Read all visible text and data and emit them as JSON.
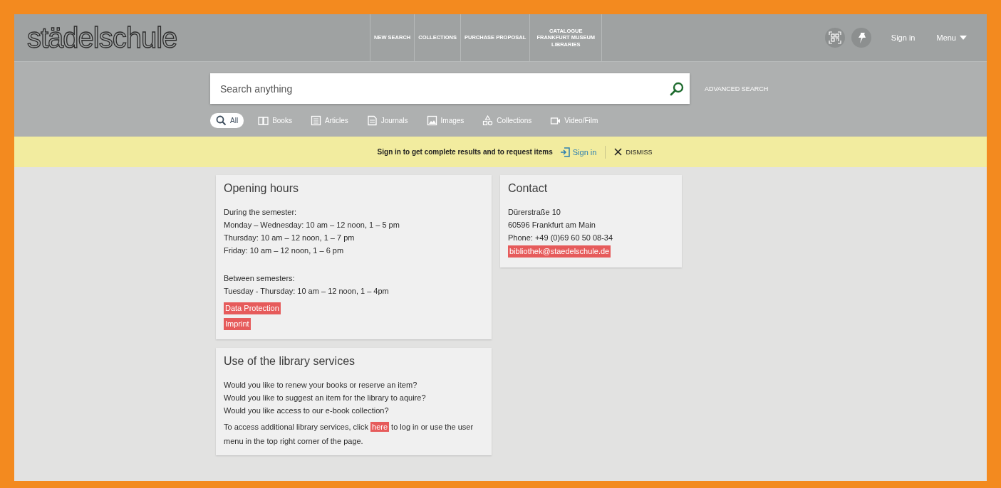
{
  "header": {
    "logo": "städelschule",
    "nav": [
      {
        "label": "NEW SEARCH"
      },
      {
        "label": "COLLECTIONS"
      },
      {
        "label": "PURCHASE PROPOSAL"
      },
      {
        "label": "CATALOGUE FRANKFURT MUSEUM LIBRARIES"
      }
    ],
    "sign_in": "Sign in",
    "menu": "Menu"
  },
  "search": {
    "placeholder": "Search anything",
    "advanced": "ADVANCED SEARCH",
    "scopes": [
      {
        "label": "All",
        "selected": true
      },
      {
        "label": "Books",
        "selected": false
      },
      {
        "label": "Articles",
        "selected": false
      },
      {
        "label": "Journals",
        "selected": false
      },
      {
        "label": "Images",
        "selected": false
      },
      {
        "label": "Collections",
        "selected": false
      },
      {
        "label": "Video/Film",
        "selected": false
      }
    ]
  },
  "banner": {
    "message": "Sign in to get complete results and to request items",
    "sign_in": "Sign in",
    "dismiss": "DISMISS"
  },
  "opening_hours": {
    "title": "Opening hours",
    "groups": [
      {
        "lines": [
          "During the semester:",
          "Monday – Wednesday: 10 am – 12 noon, 1 – 5 pm",
          "Thursday: 10 am – 12 noon, 1 – 7 pm",
          "Friday: 10 am – 12 noon, 1 – 6 pm"
        ]
      },
      {
        "lines": [
          "Between semesters:",
          "Tuesday - Thursday: 10 am – 12 noon, 1 – 4pm"
        ]
      }
    ],
    "links": [
      "Data Protection",
      "Imprint"
    ]
  },
  "contact": {
    "title": "Contact",
    "lines": [
      "Dürerstraße 10",
      "60596 Frankfurt am Main",
      "Phone: +49 (0)69 60 50 08-34"
    ],
    "email": "bibliothek@staedelschule.de"
  },
  "services": {
    "title": "Use of the library services",
    "lines": [
      "Would you like to renew your books or reserve an item?",
      "Would you like to suggest an item for the library to aquire?",
      "Would you like access to our e-book collection?"
    ],
    "access": {
      "before": "To access additional library services, click",
      "link": "here",
      "after": "to log in or use the user menu in the top right corner of the page."
    }
  }
}
